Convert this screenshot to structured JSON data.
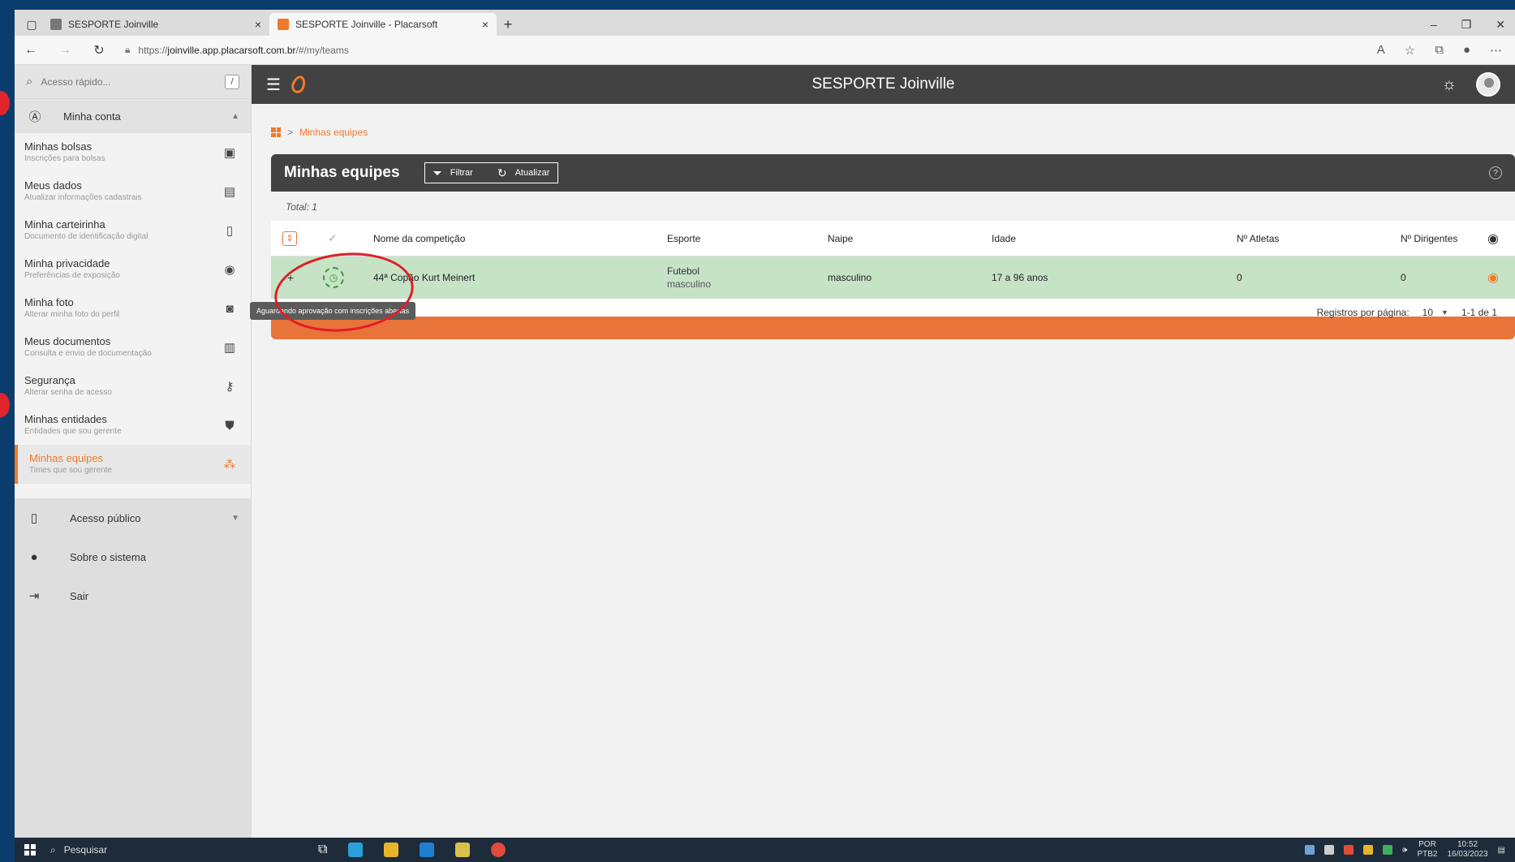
{
  "browser": {
    "tabs": [
      {
        "title": "SESPORTE Joinville",
        "active": false
      },
      {
        "title": "SESPORTE Joinville - Placarsoft",
        "active": true
      }
    ],
    "close_glyph": "×",
    "new_tab_glyph": "+",
    "url_prefix": "https://",
    "url_domain": "joinville.app.placarsoft.com.br",
    "url_path": "/#/my/teams",
    "window_controls": [
      "–",
      "❐",
      "✕"
    ]
  },
  "sidebar": {
    "search_placeholder": "Acesso rápido...",
    "search_shortcut": "/",
    "account_group": "Minha conta",
    "items": [
      {
        "label": "Minhas bolsas",
        "sub": "Inscrições para bolsas",
        "icon": "card-icon"
      },
      {
        "label": "Meus dados",
        "sub": "Atualizar informações cadastrais",
        "icon": "id-icon"
      },
      {
        "label": "Minha carteirinha",
        "sub": "Documento de identificação digital",
        "icon": "badge-icon"
      },
      {
        "label": "Minha privacidade",
        "sub": "Preferências de exposição",
        "icon": "eye-icon"
      },
      {
        "label": "Minha foto",
        "sub": "Alterar minha foto do perfil",
        "icon": "camera-icon"
      },
      {
        "label": "Meus documentos",
        "sub": "Consulta e envio de documentação",
        "icon": "document-icon"
      },
      {
        "label": "Segurança",
        "sub": "Alterar senha de acesso",
        "icon": "key-icon"
      },
      {
        "label": "Minhas entidades",
        "sub": "Entidades que sou gerente",
        "icon": "shield-icon"
      },
      {
        "label": "Minhas equipes",
        "sub": "Times que sou gerente",
        "icon": "team-icon",
        "active": true
      }
    ],
    "public_access": "Acesso público",
    "about": "Sobre o sistema",
    "logout": "Sair"
  },
  "header": {
    "app_title": "SESPORTE Joinville"
  },
  "breadcrumb": {
    "separator": ">",
    "current": "Minhas equipes"
  },
  "page": {
    "title": "Minhas equipes",
    "filter_label": "Filtrar",
    "refresh_label": "Atualizar",
    "help_glyph": "?",
    "total_label": "Total: 1"
  },
  "table": {
    "columns": [
      "Nome da competição",
      "Esporte",
      "Naipe",
      "Idade",
      "Nº Atletas",
      "Nº Dirigentes"
    ],
    "rows": [
      {
        "competition": "44ª Copão Kurt Meinert",
        "sport": "Futebol",
        "sport_sub": "masculino",
        "gender": "masculino",
        "age": "17 a 96 anos",
        "athletes": "0",
        "managers": "0"
      }
    ],
    "status_tooltip": "Aguardando aprovação com inscrições abertas",
    "rows_per_page_label": "Registros por página:",
    "rows_per_page": "10",
    "range": "1-1 de 1"
  },
  "taskbar": {
    "search_label": "Pesquisar",
    "lang": "POR",
    "lang_sub": "PTB2",
    "time": "10:52",
    "date": "16/03/2023"
  },
  "colors": {
    "accent": "#f07a2c",
    "header_bg": "#424242",
    "row_highlight": "#c6e3c5",
    "annotation": "#e01e2a"
  }
}
